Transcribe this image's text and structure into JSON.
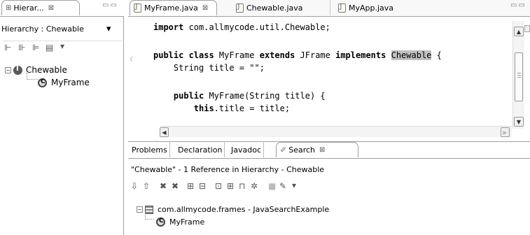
{
  "hierarchy_view": {
    "tab_label": "Hierar...",
    "close_glyph": "⊠",
    "title": "Hierarchy : Chewable",
    "dropdown_glyph": "▾",
    "toolbar_icons": [
      "type-hierarchy-icon",
      "supertype-hierarchy-icon",
      "subtype-hierarchy-icon",
      "layout-icon",
      "view-menu-icon"
    ],
    "tree": [
      {
        "label": "Chewable",
        "type": "interface",
        "expanded": true
      },
      {
        "label": "MyFrame",
        "type": "class"
      }
    ]
  },
  "editor": {
    "tabs": [
      {
        "label": "MyFrame.java",
        "active": true
      },
      {
        "label": "Chewable.java",
        "active": false
      },
      {
        "label": "MyApp.java",
        "active": false
      }
    ],
    "close_glyph": "⊠",
    "code_lines": [
      {
        "indent": "",
        "tokens": [
          {
            "t": "import",
            "kw": true
          },
          {
            "t": " com.allmycode.util.Chewable;"
          }
        ]
      },
      {
        "indent": "",
        "tokens": []
      },
      {
        "indent": "",
        "tokens": [
          {
            "t": "public class",
            "kw": true
          },
          {
            "t": " MyFrame "
          },
          {
            "t": "extends",
            "kw": true
          },
          {
            "t": " JFrame "
          },
          {
            "t": "implements",
            "kw": true
          },
          {
            "t": " "
          },
          {
            "t": "Chewable",
            "hl": true
          },
          {
            "t": " {"
          }
        ]
      },
      {
        "indent": "    ",
        "tokens": [
          {
            "t": "String title = \"\";"
          }
        ]
      },
      {
        "indent": "",
        "tokens": []
      },
      {
        "indent": "    ",
        "tokens": [
          {
            "t": "public",
            "kw": true
          },
          {
            "t": " MyFrame(String title) {"
          }
        ]
      },
      {
        "indent": "        ",
        "tokens": [
          {
            "t": "this",
            "kw": true
          },
          {
            "t": ".title = title;"
          }
        ]
      }
    ]
  },
  "bottom_panel": {
    "tabs": [
      {
        "label": "Problems",
        "active": false
      },
      {
        "label": "Declaration",
        "active": false
      },
      {
        "label": "Javadoc",
        "active": false
      },
      {
        "label": "Search",
        "active": true
      }
    ],
    "close_glyph": "⊠",
    "summary": "\"Chewable\" - 1 Reference in Hierarchy - Chewable",
    "results": [
      {
        "label": "com.allmycode.frames - JavaSearchExample",
        "type": "package"
      },
      {
        "label": "MyFrame",
        "type": "class"
      }
    ]
  }
}
